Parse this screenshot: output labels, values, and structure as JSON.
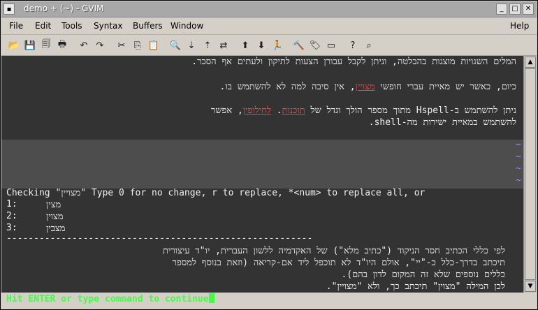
{
  "window": {
    "title": "demo + (~) - GVIM",
    "minimize_label": "_",
    "maximize_label": "□",
    "close_label": "✕"
  },
  "menubar": {
    "items": [
      "File",
      "Edit",
      "Tools",
      "Syntax",
      "Buffers",
      "Window"
    ],
    "help": "Help"
  },
  "toolbar": {
    "icons": [
      "open-icon",
      "save-icon",
      "save-all-icon",
      "print-icon",
      "undo-icon",
      "redo-icon",
      "cut-icon",
      "copy-icon",
      "paste-icon",
      "find-icon",
      "find-next-icon",
      "find-prev-icon",
      "replace-icon",
      "load-session-icon",
      "save-session-icon",
      "run-script-icon",
      "make-icon",
      "tags-icon",
      "jump-tag-icon",
      "help-icon",
      "find-help-icon"
    ]
  },
  "editor": {
    "text_lines": [
      "המלים השגויות מוצגות בהבלטה, וניתן לקבל עבורן הצעות לתיקון ולעתים אף הסבר.",
      "כיום, כאשר יש מאיית עברי חופשי מצויין, אין סיבה למה לא להשתמש בו.",
      "ניתן להשתמש ב-Hspell מתוך מספר הולך וגדל של תוכנות. לחילופין, אפשר",
      "להשתמש במאיית ישירות מה-shell."
    ],
    "highlight_words": [
      "מצויין",
      "תוכנות",
      "לחילופין"
    ],
    "tilde": "~",
    "spell_prompt": "Checking \"מצויין\" Type 0 for no change, r to replace, *<num> to replace all, or",
    "options": [
      {
        "num": "1:",
        "word": "מצין"
      },
      {
        "num": "2:",
        "word": "מצוין"
      },
      {
        "num": "3:",
        "word": "מצבין"
      }
    ],
    "separator": "--------------------------------------------------------",
    "explanation": [
      "לפי כללי הכתיב חסר הניקוד (\"כתיב מלא\") של האקדמיה ללשון העברית, יו\"ד עיצורית",
      "תיכתב בדרך-כלל כ-\"יי\", אולם היו\"ד לא תוכפל ליד אם-קריאה (וזאת בנוסף למספר",
      "כללים נוספים שלא זה המקום לדון בהם).",
      "לכן המילה \"מצוין\" תיכתב כך, ולא \"מצויין\"."
    ],
    "hit_enter": "Hit ENTER or type command to continue"
  },
  "colors": {
    "background": "#333333",
    "text": "#f0f0f0",
    "spell_error": "#ff4040",
    "more_msg": "#40ff40",
    "tilde": "#9090ff"
  }
}
